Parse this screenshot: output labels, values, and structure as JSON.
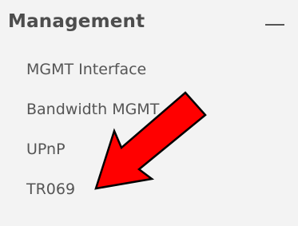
{
  "panel": {
    "title": "Management",
    "collapse_icon": "minus-icon",
    "items": [
      {
        "label": "MGMT Interface"
      },
      {
        "label": "Bandwidth MGMT"
      },
      {
        "label": "UPnP"
      },
      {
        "label": "TR069"
      }
    ]
  },
  "annotation": {
    "icon": "red-arrow-icon",
    "color": "#ff0000",
    "outline_color": "#000000",
    "points_to": "TR069"
  },
  "colors": {
    "panel_background": "#f3f3f3",
    "title_text": "#4d4d4d",
    "item_text": "#555555"
  }
}
